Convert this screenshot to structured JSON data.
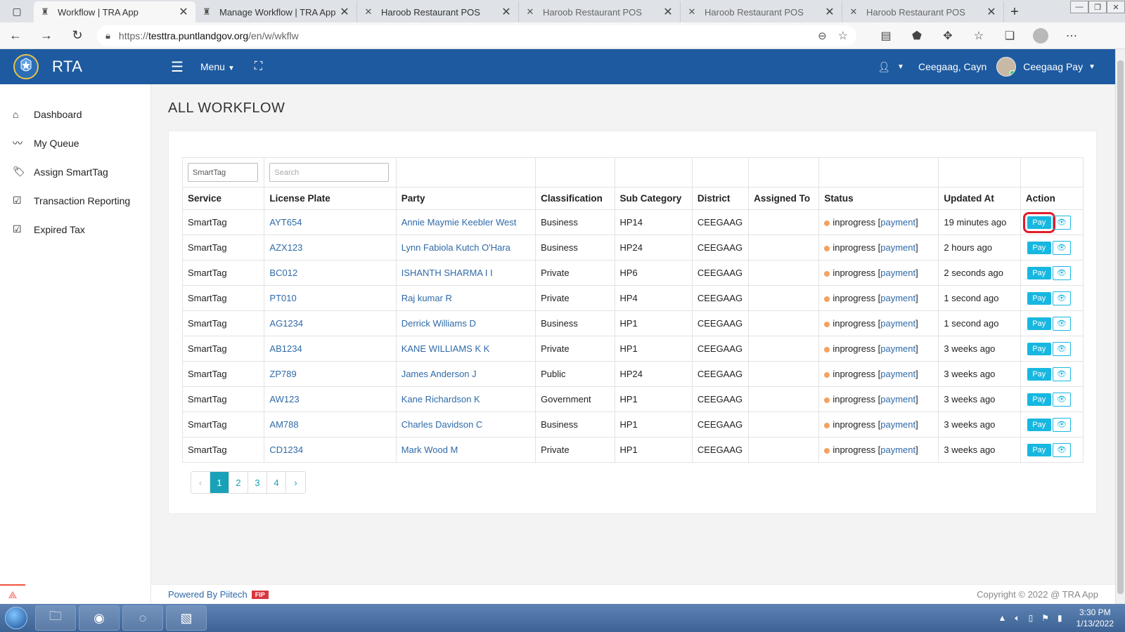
{
  "browser": {
    "tabs": [
      {
        "title": "Workflow | TRA App",
        "active": true
      },
      {
        "title": "Manage Workflow | TRA App",
        "active": false
      },
      {
        "title": "Haroob Restaurant POS",
        "active": false
      },
      {
        "title": "Haroob Restaurant POS",
        "active": false
      },
      {
        "title": "Haroob Restaurant POS",
        "active": false
      },
      {
        "title": "Haroob Restaurant POS",
        "active": false
      }
    ],
    "url_prefix": "https://",
    "url_host": "testtra.puntlandgov.org",
    "url_path": "/en/w/wkflw"
  },
  "header": {
    "brand": "RTA",
    "menu_label": "Menu",
    "location": "Ceegaag, Cayn",
    "user_name": "Ceegaag Pay"
  },
  "sidebar": {
    "items": [
      {
        "label": "Dashboard",
        "icon": "home-icon"
      },
      {
        "label": "My Queue",
        "icon": "trend-icon"
      },
      {
        "label": "Assign SmartTag",
        "icon": "tags-icon"
      },
      {
        "label": "Transaction Reporting",
        "icon": "checkbox-icon"
      },
      {
        "label": "Expired Tax",
        "icon": "checkbox-icon"
      }
    ]
  },
  "page": {
    "title": "ALL WORKFLOW",
    "filters": {
      "service_value": "SmartTag",
      "plate_placeholder": "Search"
    },
    "columns": [
      "Service",
      "License Plate",
      "Party",
      "Classification",
      "Sub Category",
      "District",
      "Assigned To",
      "Status",
      "Updated At",
      "Action"
    ],
    "rows": [
      {
        "service": "SmartTag",
        "plate": "AYT654",
        "party": "Annie Maymie Keebler West",
        "classification": "Business",
        "sub": "HP14",
        "district": "CEEGAAG",
        "assigned": "",
        "status": "inprogress",
        "status_link": "payment",
        "updated": "19 minutes ago"
      },
      {
        "service": "SmartTag",
        "plate": "AZX123",
        "party": "Lynn Fabiola Kutch O'Hara",
        "classification": "Business",
        "sub": "HP24",
        "district": "CEEGAAG",
        "assigned": "",
        "status": "inprogress",
        "status_link": "payment",
        "updated": "2 hours ago"
      },
      {
        "service": "SmartTag",
        "plate": "BC012",
        "party": "ISHANTH SHARMA I I",
        "classification": "Private",
        "sub": "HP6",
        "district": "CEEGAAG",
        "assigned": "",
        "status": "inprogress",
        "status_link": "payment",
        "updated": "2 seconds ago"
      },
      {
        "service": "SmartTag",
        "plate": "PT010",
        "party": "Raj kumar R",
        "classification": "Private",
        "sub": "HP4",
        "district": "CEEGAAG",
        "assigned": "",
        "status": "inprogress",
        "status_link": "payment",
        "updated": "1 second ago"
      },
      {
        "service": "SmartTag",
        "plate": "AG1234",
        "party": "Derrick Williams D",
        "classification": "Business",
        "sub": "HP1",
        "district": "CEEGAAG",
        "assigned": "",
        "status": "inprogress",
        "status_link": "payment",
        "updated": "1 second ago"
      },
      {
        "service": "SmartTag",
        "plate": "AB1234",
        "party": "KANE WILLIAMS K K",
        "classification": "Private",
        "sub": "HP1",
        "district": "CEEGAAG",
        "assigned": "",
        "status": "inprogress",
        "status_link": "payment",
        "updated": "3 weeks ago"
      },
      {
        "service": "SmartTag",
        "plate": "ZP789",
        "party": "James Anderson J",
        "classification": "Public",
        "sub": "HP24",
        "district": "CEEGAAG",
        "assigned": "",
        "status": "inprogress",
        "status_link": "payment",
        "updated": "3 weeks ago"
      },
      {
        "service": "SmartTag",
        "plate": "AW123",
        "party": "Kane Richardson K",
        "classification": "Government",
        "sub": "HP1",
        "district": "CEEGAAG",
        "assigned": "",
        "status": "inprogress",
        "status_link": "payment",
        "updated": "3 weeks ago"
      },
      {
        "service": "SmartTag",
        "plate": "AM788",
        "party": "Charles Davidson C",
        "classification": "Business",
        "sub": "HP1",
        "district": "CEEGAAG",
        "assigned": "",
        "status": "inprogress",
        "status_link": "payment",
        "updated": "3 weeks ago"
      },
      {
        "service": "SmartTag",
        "plate": "CD1234",
        "party": "Mark Wood M",
        "classification": "Private",
        "sub": "HP1",
        "district": "CEEGAAG",
        "assigned": "",
        "status": "inprogress",
        "status_link": "payment",
        "updated": "3 weeks ago"
      }
    ],
    "pay_label": "Pay",
    "pagination": {
      "prev": "‹",
      "pages": [
        "1",
        "2",
        "3",
        "4"
      ],
      "current": "1",
      "next": "›"
    }
  },
  "footer": {
    "powered": "Powered By Piitech",
    "badge": "FIP",
    "copyright": "Copyright © 2022 @ TRA App"
  },
  "taskbar": {
    "time": "3:30 PM",
    "date": "1/13/2022"
  },
  "colors": {
    "header_bg": "#1e5aa0",
    "accent": "#17b7e0",
    "status_dot": "#f4a261",
    "highlight": "#e11d2b"
  }
}
